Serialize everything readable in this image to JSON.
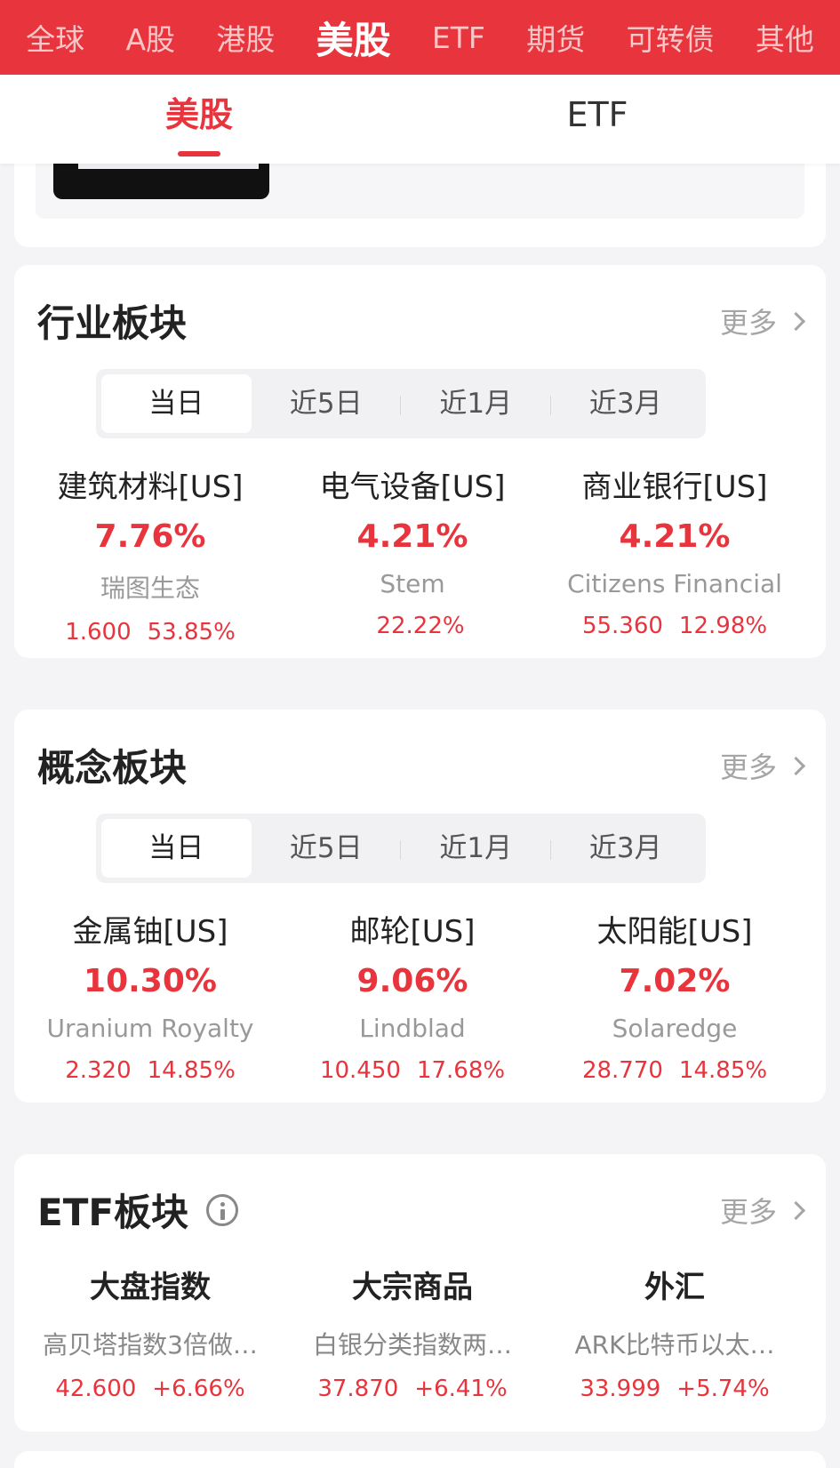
{
  "top_tabs": [
    "全球",
    "A股",
    "港股",
    "美股",
    "ETF",
    "期货",
    "可转债",
    "其他"
  ],
  "top_tab_active": "美股",
  "sub_tabs": [
    "美股",
    "ETF"
  ],
  "colors": {
    "brand_red": "#e8343c",
    "up_red": "#e8343c",
    "muted_gray": "#999999"
  },
  "icons": [
    "info-icon",
    "chevron-right-icon"
  ],
  "periods": [
    "当日",
    "近5日",
    "近1月",
    "近3月"
  ],
  "industry": {
    "title": "行业板块",
    "more": "更多",
    "items": [
      {
        "name": "建筑材料[US]",
        "change": "7.76%",
        "stock": "瑞图生态",
        "price": "1.600",
        "pct": "53.85%"
      },
      {
        "name": "电气设备[US]",
        "change": "4.21%",
        "stock": "Stem",
        "price": "",
        "pct": "22.22%"
      },
      {
        "name": "商业银行[US]",
        "change": "4.21%",
        "stock": "Citizens Financial",
        "price": "55.360",
        "pct": "12.98%"
      }
    ]
  },
  "concept": {
    "title": "概念板块",
    "more": "更多",
    "items": [
      {
        "name": "金属铀[US]",
        "change": "10.30%",
        "stock": "Uranium Royalty",
        "price": "2.320",
        "pct": "14.85%"
      },
      {
        "name": "邮轮[US]",
        "change": "9.06%",
        "stock": "Lindblad",
        "price": "10.450",
        "pct": "17.68%"
      },
      {
        "name": "太阳能[US]",
        "change": "7.02%",
        "stock": "Solaredge",
        "price": "28.770",
        "pct": "14.85%"
      }
    ]
  },
  "etf": {
    "title": "ETF板块",
    "more": "更多",
    "items": [
      {
        "name": "大盘指数",
        "desc": "高贝塔指数3倍做…",
        "price": "42.600",
        "pct": "+6.66%"
      },
      {
        "name": "大宗商品",
        "desc": "白银分类指数两…",
        "price": "37.870",
        "pct": "+6.41%"
      },
      {
        "name": "外汇",
        "desc": "ARK比特币以太…",
        "price": "33.999",
        "pct": "+5.74%"
      }
    ]
  }
}
